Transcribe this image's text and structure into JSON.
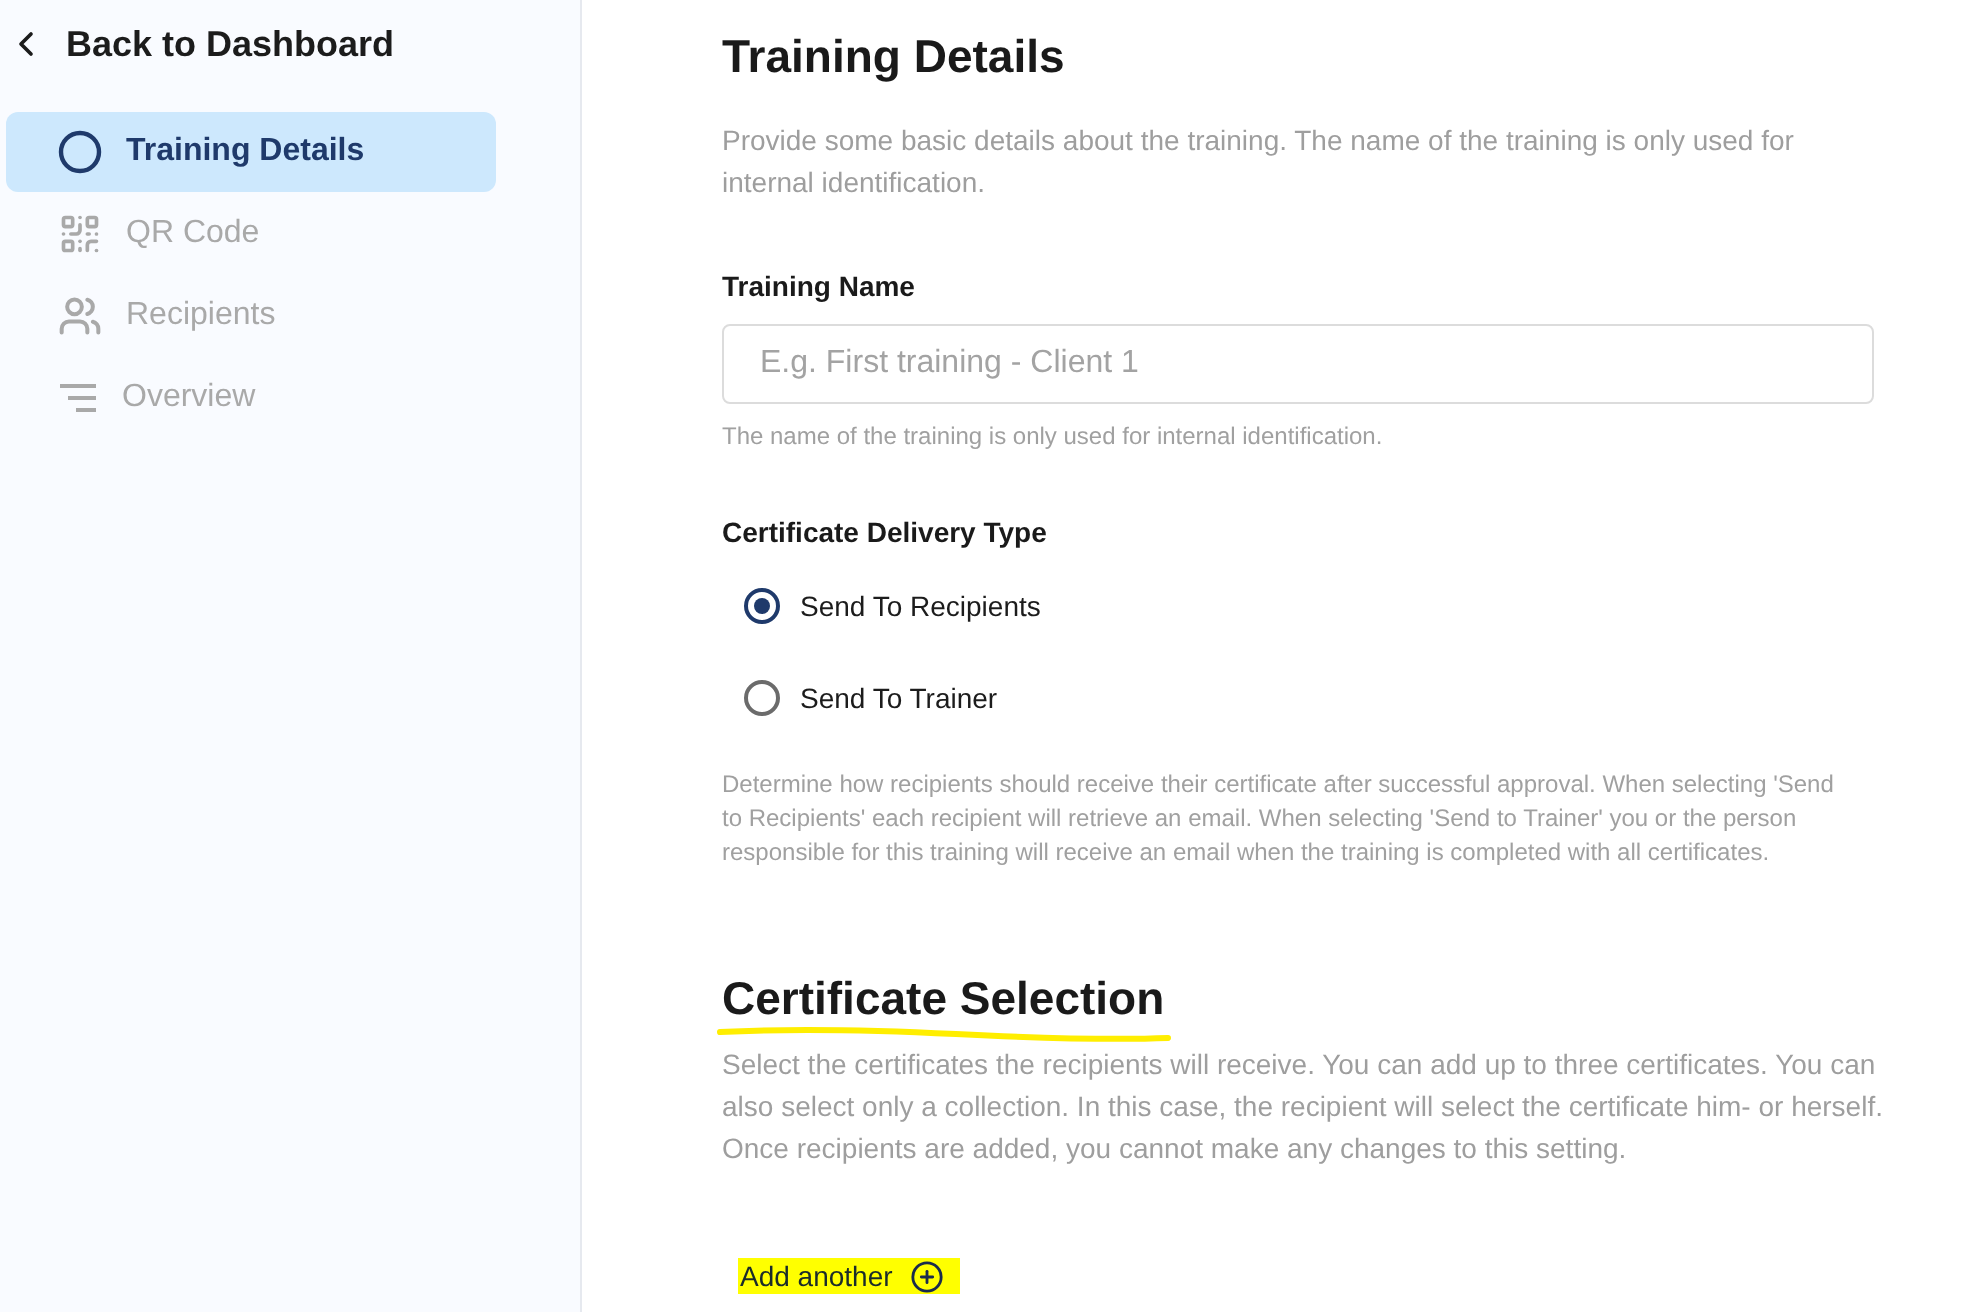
{
  "sidebar": {
    "back_link": {
      "label": "Back to Dashboard"
    },
    "items": [
      {
        "label": "Training Details",
        "selected": true
      },
      {
        "label": "QR Code",
        "selected": false
      },
      {
        "label": "Recipients",
        "selected": false
      },
      {
        "label": "Overview",
        "selected": false
      }
    ]
  },
  "training_details": {
    "title": "Training Details",
    "description": "Provide some basic details about the training. The name of the training is only used for internal identification.",
    "training_name": {
      "label": "Training Name",
      "placeholder": "E.g. First training - Client 1",
      "hint": "The name of the training is only used for internal identification."
    },
    "delivery_type": {
      "label": "Certificate Delivery Type",
      "options": [
        {
          "label": "Send To Recipients",
          "selected": true
        },
        {
          "label": "Send To Trainer",
          "selected": false
        }
      ],
      "hint": "Determine how recipients should receive their certificate after successful approval. When selecting 'Send to Recipients' each recipient will retrieve an email. When selecting 'Send to Trainer' you or the person responsible for this training will receive an email when the training is completed with all certificates."
    }
  },
  "certificate_selection": {
    "title": "Certificate Selection",
    "highlighted": true,
    "description": "Select the certificates the recipients will receive. You can add up to three certificates. You can also select only a collection. In this case, the recipient will select the certificate him- or herself. Once recipients are added, you cannot make any changes to this setting.",
    "add_button": {
      "label": "Add another",
      "highlighted": true
    }
  }
}
